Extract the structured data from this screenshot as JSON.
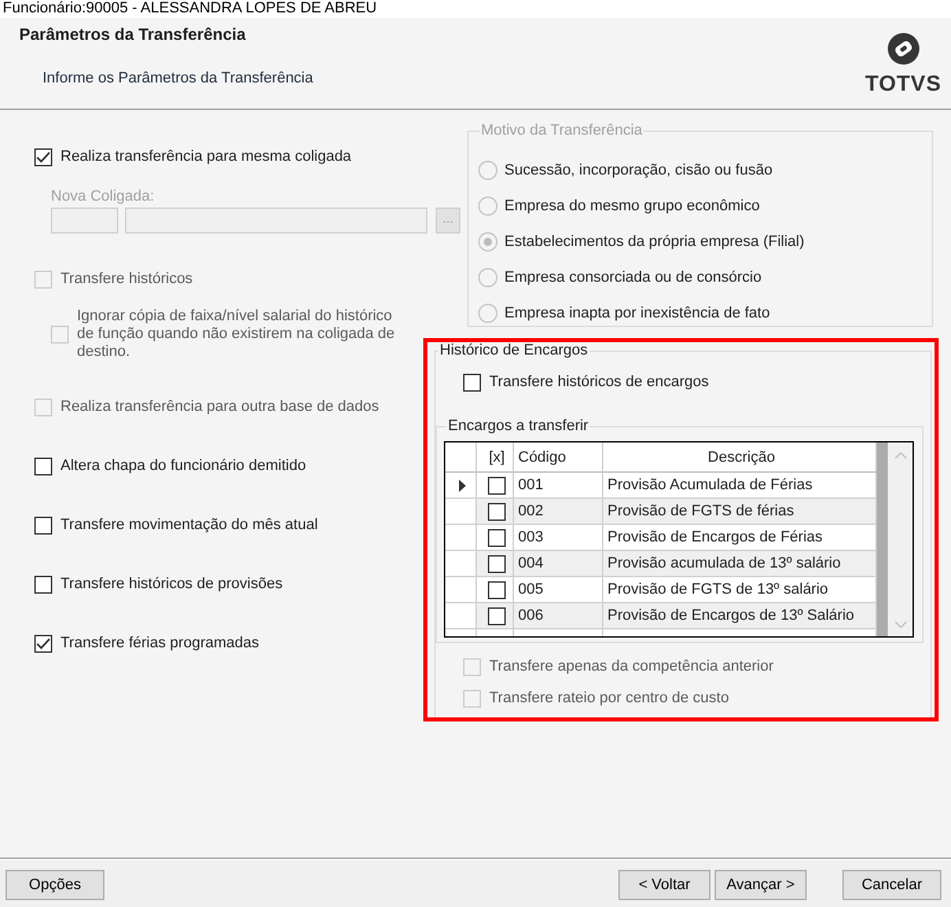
{
  "window": {
    "title": "Funcionário:90005 - ALESSANDRA LOPES DE ABREU"
  },
  "header": {
    "title": "Parâmetros da Transferência",
    "subtitle": "Informe os Parâmetros da Transferência",
    "logo_text": "TOTVS"
  },
  "options": [
    {
      "kind": "checkbox",
      "label": "Realiza transferência para mesma coligada",
      "checked": true,
      "disabled": false
    },
    {
      "kind": "lookup",
      "label": "Nova Coligada:",
      "button_label": "...",
      "disabled": true
    },
    {
      "kind": "checkbox",
      "label": "Transfere históricos",
      "checked": false,
      "disabled": true
    },
    {
      "kind": "subcheckbox",
      "label": "Ignorar cópia de faixa/nível salarial do histórico de função quando não existirem na coligada de destino.",
      "checked": false,
      "disabled": true
    },
    {
      "kind": "checkbox",
      "label": "Realiza transferência para outra base de dados",
      "checked": false,
      "disabled": true
    },
    {
      "kind": "checkbox",
      "label": "Altera chapa do funcionário demitido",
      "checked": false,
      "disabled": false
    },
    {
      "kind": "checkbox",
      "label": "Transfere movimentação do mês atual",
      "checked": false,
      "disabled": false
    },
    {
      "kind": "checkbox",
      "label": "Transfere históricos de provisões",
      "checked": false,
      "disabled": false
    },
    {
      "kind": "checkbox",
      "label": "Transfere férias programadas",
      "checked": true,
      "disabled": false
    }
  ],
  "reason_group": {
    "title": "Motivo da Transferência",
    "disabled": true,
    "options": [
      {
        "label": "Sucessão, incorporação, cisão ou fusão",
        "selected": false
      },
      {
        "label": "Empresa do mesmo grupo econômico",
        "selected": false
      },
      {
        "label": "Estabelecimentos da própria empresa (Filial)",
        "selected": true
      },
      {
        "label": "Empresa consorciada ou de consórcio",
        "selected": false
      },
      {
        "label": "Empresa inapta por inexistência de fato",
        "selected": false
      }
    ]
  },
  "charges_group": {
    "title": "Histórico de Encargos",
    "highlighted": true,
    "transfer_option": {
      "label": "Transfere históricos de encargos",
      "checked": false
    },
    "table_group": {
      "title": "Encargos a transferir",
      "columns": [
        "[x]",
        "Código",
        "Descrição"
      ],
      "rows": [
        {
          "current": true,
          "checked": false,
          "code": "001",
          "description": "Provisão Acumulada de Férias"
        },
        {
          "current": false,
          "checked": false,
          "code": "002",
          "description": "Provisão de FGTS de férias"
        },
        {
          "current": false,
          "checked": false,
          "code": "003",
          "description": "Provisão de Encargos de Férias"
        },
        {
          "current": false,
          "checked": false,
          "code": "004",
          "description": "Provisão acumulada de 13º salário"
        },
        {
          "current": false,
          "checked": false,
          "code": "005",
          "description": "Provisão de FGTS de 13º salário"
        },
        {
          "current": false,
          "checked": false,
          "code": "006",
          "description": "Provisão de Encargos de 13º Salário"
        }
      ]
    },
    "options": [
      {
        "label": "Transfere apenas da competência anterior",
        "checked": false,
        "disabled": true
      },
      {
        "label": "Transfere rateio por centro de custo",
        "checked": false,
        "disabled": true
      }
    ]
  },
  "footer": {
    "left_buttons": [
      "Opções"
    ],
    "nav_buttons": [
      "< Voltar",
      "Avançar >"
    ],
    "right_buttons": [
      "Cancelar"
    ]
  }
}
